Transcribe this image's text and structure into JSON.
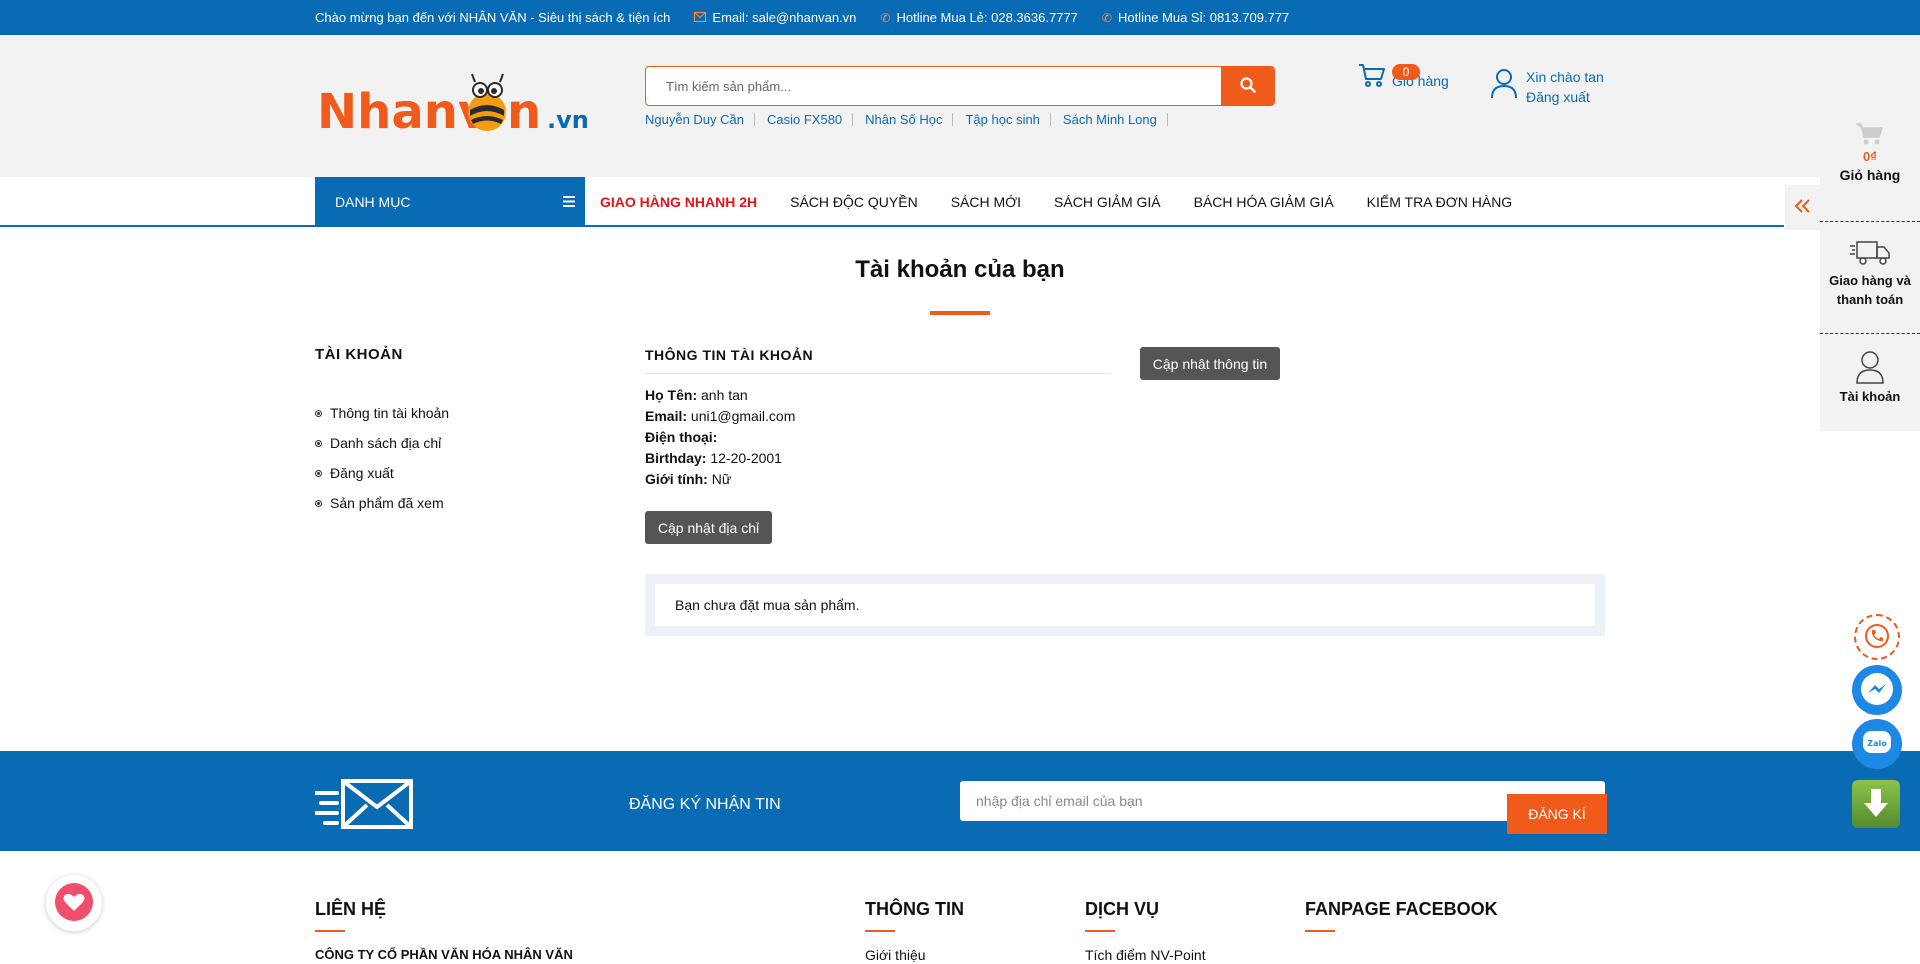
{
  "topbar": {
    "welcome": "Chào mừng bạn đến với NHÂN VĂN - Siêu thị sách & tiện ích",
    "email": "Email: sale@nhanvan.vn",
    "hotline_retail": "Hotline Mua Lẻ: 028.3636.7777",
    "hotline_wholesale": "Hotline Mua Sỉ: 0813.709.777"
  },
  "logo": {
    "text_main": "Nhanv",
    "text_tail": "n",
    "text_domain": ".vn"
  },
  "search": {
    "placeholder": "Tìm kiếm sản phẩm...",
    "keywords": [
      "Nguyễn Duy Cần",
      "Casio FX580",
      "Nhân Số Học",
      "Tập học sinh",
      "Sách Minh Long"
    ]
  },
  "cart": {
    "count": "0",
    "label": "Giỏ hàng"
  },
  "account": {
    "greeting": "Xin chào tan",
    "logout": "Đăng xuất"
  },
  "nav": {
    "category": "DANH MỤC",
    "links": [
      "GIAO HÀNG NHANH 2H",
      "SÁCH ĐỘC QUYỀN",
      "SÁCH MỚI",
      "SÁCH GIẢM GIÁ",
      "BÁCH HÓA GIẢM GIÁ",
      "KIỂM TRA ĐƠN HÀNG"
    ]
  },
  "page": {
    "title": "Tài khoản của bạn"
  },
  "sidebar": {
    "heading": "TÀI KHOẢN",
    "items": [
      "Thông tin tài khoản",
      "Danh sách địa chỉ",
      "Đăng xuất",
      "Sản phẩm đã xem"
    ]
  },
  "info": {
    "heading": "THÔNG TIN TÀI KHOẢN",
    "update_info_button": "Cập nhật thông tin",
    "update_address_button": "Cập nhật địa chỉ",
    "name_label": "Họ Tên:",
    "name_value": "anh tan",
    "email_label": "Email:",
    "email_value": "uni1@gmail.com",
    "phone_label": "Điện thoại:",
    "phone_value": "",
    "birthday_label": "Birthday:",
    "birthday_value": "12-20-2001",
    "gender_label": "Giới tính:",
    "gender_value": "Nữ"
  },
  "orders": {
    "empty_message": "Bạn chưa đặt mua sản phẩm."
  },
  "newsletter": {
    "title": "ĐĂNG KÝ NHẬN TIN",
    "placeholder": "nhập địa chỉ email của bạn",
    "submit": "ĐĂNG KÍ"
  },
  "footer": {
    "col1": "LIÊN HỆ",
    "col1_sub": "CÔNG TY CỔ PHẦN VĂN HÓA NHÂN VĂN",
    "col2": "THÔNG TIN",
    "col2_sub": "Giới thiệu",
    "col3": "DỊCH VỤ",
    "col3_sub": "Tích điểm NV-Point",
    "col4": "FANPAGE FACEBOOK"
  },
  "rightbar": {
    "cart_amount": "0₫",
    "cart_label": "Giỏ hàng",
    "shipping_label": "Giao hàng và thanh toán",
    "account_label": "Tài khoản"
  },
  "icons": [
    "envelope-icon",
    "phone-icon",
    "search-icon",
    "cart-icon",
    "user-icon",
    "menu-icon",
    "truck-icon",
    "double-chevron-left-icon",
    "phone-call-icon",
    "messenger-icon",
    "zalo-icon",
    "download-icon",
    "heart-icon",
    "mail-fast-icon"
  ],
  "colors": {
    "brand_blue": "#0a6bb5",
    "accent_orange": "#f05a1a",
    "hot_red": "#e3141b"
  }
}
